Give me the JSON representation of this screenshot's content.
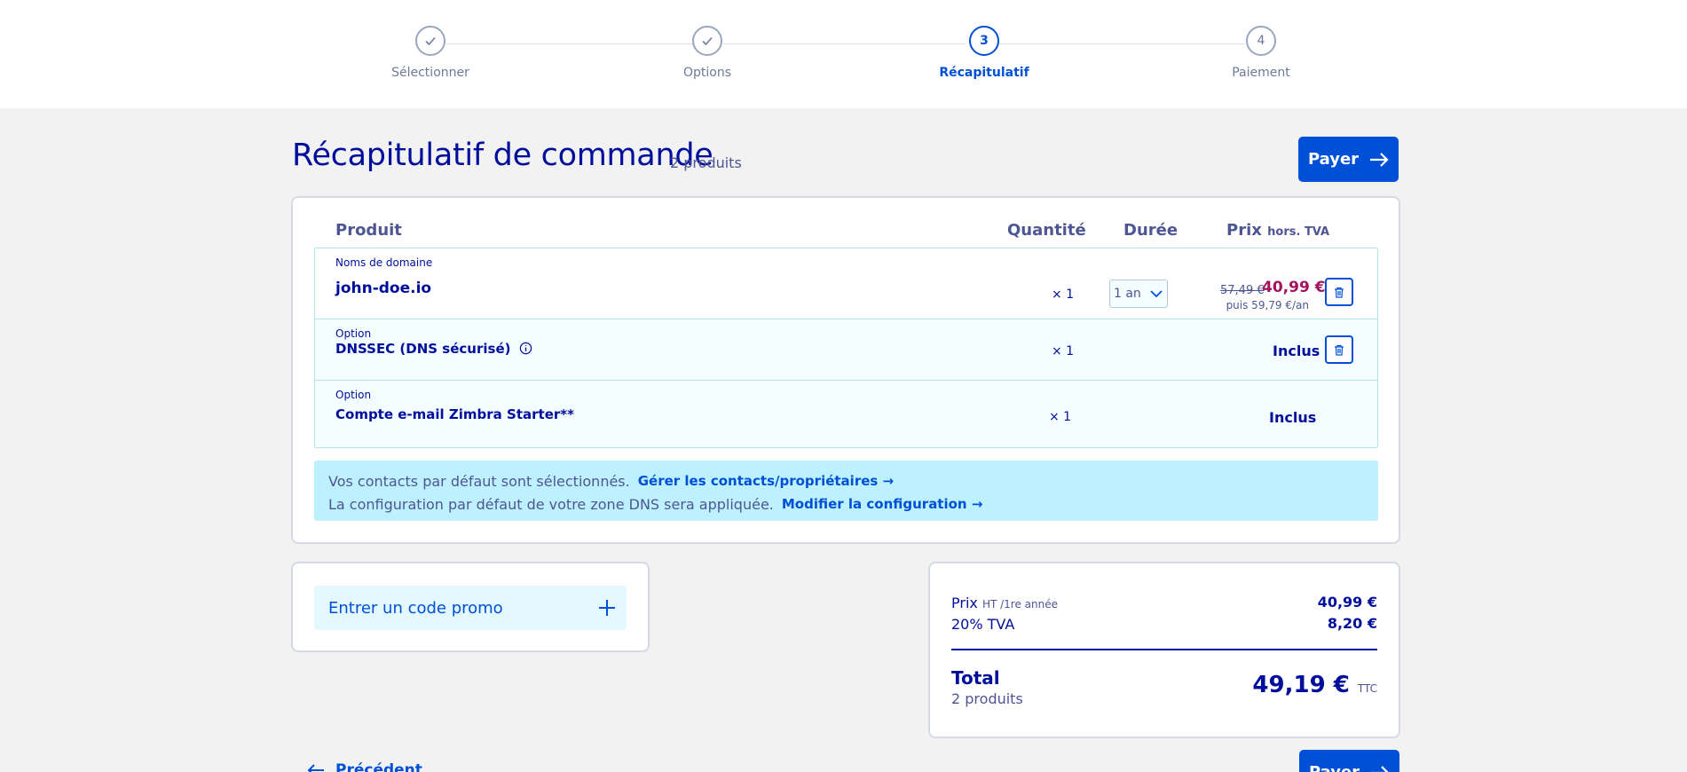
{
  "stepper": {
    "steps": [
      {
        "label": "Sélectionner",
        "state": "done"
      },
      {
        "label": "Options",
        "state": "done"
      },
      {
        "label": "Récapitulatif",
        "number": "3",
        "state": "active"
      },
      {
        "label": "Paiement",
        "number": "4",
        "state": "todo"
      }
    ]
  },
  "header": {
    "title": "Récapitulatif de commande",
    "count": "2 produits",
    "pay_label": "Payer"
  },
  "table": {
    "columns": {
      "product": "Produit",
      "quantity": "Quantité",
      "duration": "Durée",
      "price": "Prix",
      "price_suffix": "hors. TVA"
    },
    "rows": [
      {
        "category": "Noms de domaine",
        "name": "john-doe.io",
        "quantity": "× 1",
        "duration": "1 an",
        "old_price": "57,49 €",
        "price": "40,99 €",
        "then": "puis 59,79 €/an"
      },
      {
        "category": "Option",
        "name": "DNSSEC (DNS sécurisé)",
        "quantity": "× 1",
        "price": "Inclus"
      },
      {
        "category": "Option",
        "name": "Compte e-mail Zimbra Starter**",
        "quantity": "× 1",
        "price": "Inclus"
      }
    ]
  },
  "notice": {
    "contacts_text": "Vos contacts par défaut sont sélectionnés.",
    "contacts_link": "Gérer les contacts/propriétaires",
    "dns_text": "La configuration par défaut de votre zone DNS sera appliquée.",
    "dns_link": "Modifier la configuration"
  },
  "promo": {
    "label": "Entrer un code promo"
  },
  "summary": {
    "price_label": "Prix",
    "price_suffix": "HT /1re année",
    "price_value": "40,99 €",
    "vat_label": "20% TVA",
    "vat_value": "8,20 €",
    "total_label": "Total",
    "total_count": "2 produits",
    "total_value": "49,19 €",
    "total_suffix": "TTC"
  },
  "footer": {
    "previous_label": "Précédent",
    "pay_label": "Payer"
  },
  "colors": {
    "primary": "#0050d7",
    "navy": "#000e9c",
    "promo_price": "#a3125e",
    "notice_bg": "#bef1ff"
  }
}
